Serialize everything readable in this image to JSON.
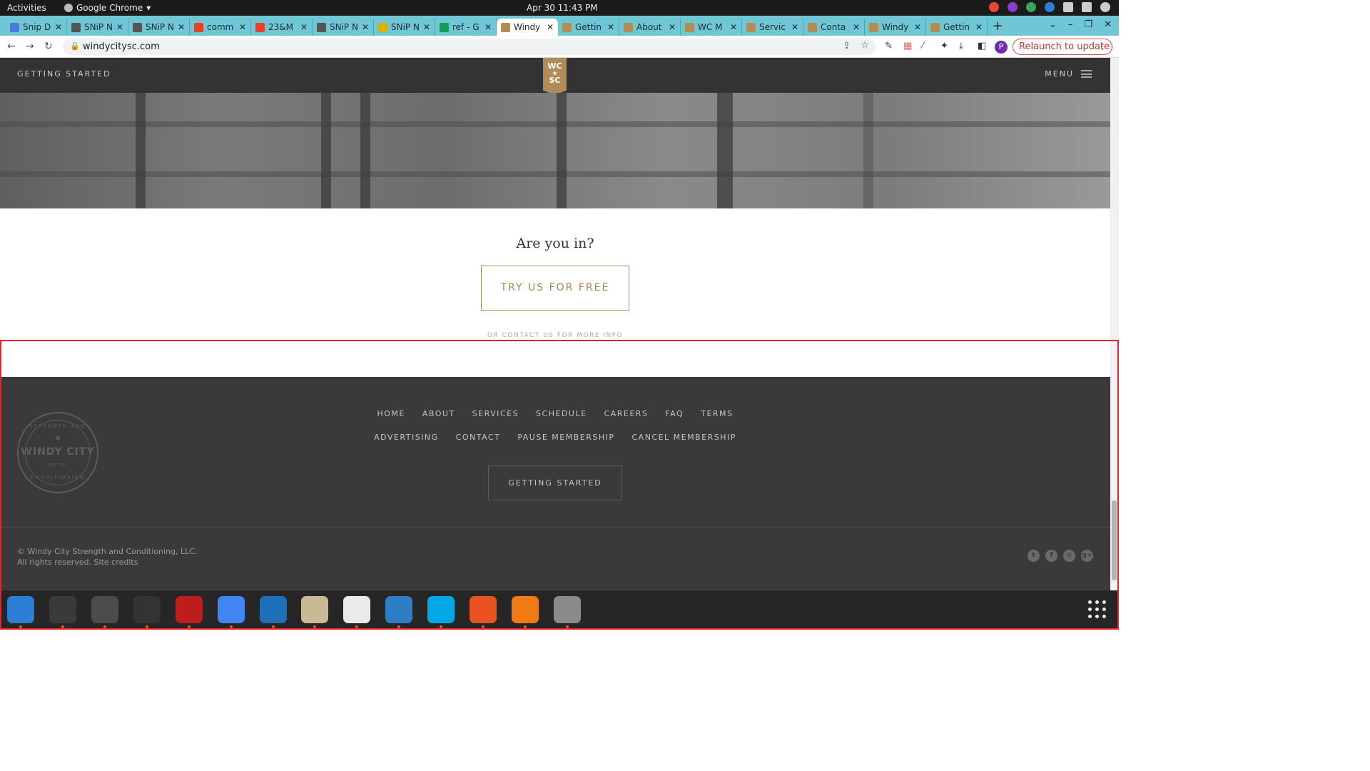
{
  "system": {
    "activities": "Activities",
    "app_name": "Google Chrome",
    "clock": "Apr 30  11:43 PM"
  },
  "tabs": [
    {
      "label": "Snip D",
      "favicon": "#4a7bd6"
    },
    {
      "label": "SNiP N",
      "favicon": "#555"
    },
    {
      "label": "SNiP N",
      "favicon": "#555"
    },
    {
      "label": "comm",
      "favicon": "#e24329"
    },
    {
      "label": "23&M",
      "favicon": "#e24329"
    },
    {
      "label": "SNiP N",
      "favicon": "#555"
    },
    {
      "label": "SNiP N",
      "favicon": "#d9b300"
    },
    {
      "label": "ref - G",
      "favicon": "#0f9d58"
    },
    {
      "label": "Windy",
      "favicon": "#b08d57",
      "active": true
    },
    {
      "label": "Gettin",
      "favicon": "#b08d57"
    },
    {
      "label": "About",
      "favicon": "#b08d57"
    },
    {
      "label": "WC M",
      "favicon": "#b08d57"
    },
    {
      "label": "Servic",
      "favicon": "#b08d57"
    },
    {
      "label": "Conta",
      "favicon": "#b08d57"
    },
    {
      "label": "Windy",
      "favicon": "#b08d57"
    },
    {
      "label": "Gettin",
      "favicon": "#b08d57"
    }
  ],
  "address_bar": {
    "url": "windycitysc.com",
    "relaunch": "Relaunch to update",
    "profile_initial": "P"
  },
  "site_header": {
    "getting_started": "GETTING STARTED",
    "logo_line1": "WC",
    "logo_line2": "SC",
    "menu": "MENU"
  },
  "cta": {
    "question": "Are you in?",
    "button": "TRY US FOR FREE",
    "contact_line": "OR CONTACT US FOR MORE INFO"
  },
  "footer": {
    "badge_top": "STRENGTH AND",
    "badge_name": "WINDY CITY",
    "badge_est": "EST. 2007",
    "badge_bottom": "CONDITIONING",
    "links_row1": [
      "HOME",
      "ABOUT",
      "SERVICES",
      "SCHEDULE",
      "CAREERS",
      "FAQ",
      "TERMS"
    ],
    "links_row2": [
      "ADVERTISING",
      "CONTACT",
      "PAUSE MEMBERSHIP",
      "CANCEL MEMBERSHIP"
    ],
    "getting_started": "GETTING STARTED",
    "copyright": "© Windy City Strength and Conditioning, LLC.",
    "rights": "All rights reserved. Site credits",
    "social": [
      "twitter-icon",
      "facebook-icon",
      "instagram-icon",
      "google-plus-icon"
    ]
  },
  "dock": [
    {
      "name": "thunderbird",
      "color": "#2b7fd6"
    },
    {
      "name": "terminal",
      "color": "#3a3a3a"
    },
    {
      "name": "calculator",
      "color": "#4c4c4c"
    },
    {
      "name": "system-monitor",
      "color": "#333"
    },
    {
      "name": "filezilla",
      "color": "#bf1c1c"
    },
    {
      "name": "chrome",
      "color": "#4285f4"
    },
    {
      "name": "vscode",
      "color": "#1d6fb8"
    },
    {
      "name": "files",
      "color": "#c9b995"
    },
    {
      "name": "text-editor",
      "color": "#eaeaea"
    },
    {
      "name": "libreoffice-writer",
      "color": "#2d7ec4"
    },
    {
      "name": "skype",
      "color": "#00a9e6"
    },
    {
      "name": "inkscape-pen",
      "color": "#e9531f"
    },
    {
      "name": "firefox-dev",
      "color": "#f07b12"
    },
    {
      "name": "disks",
      "color": "#8a8a8a"
    }
  ]
}
